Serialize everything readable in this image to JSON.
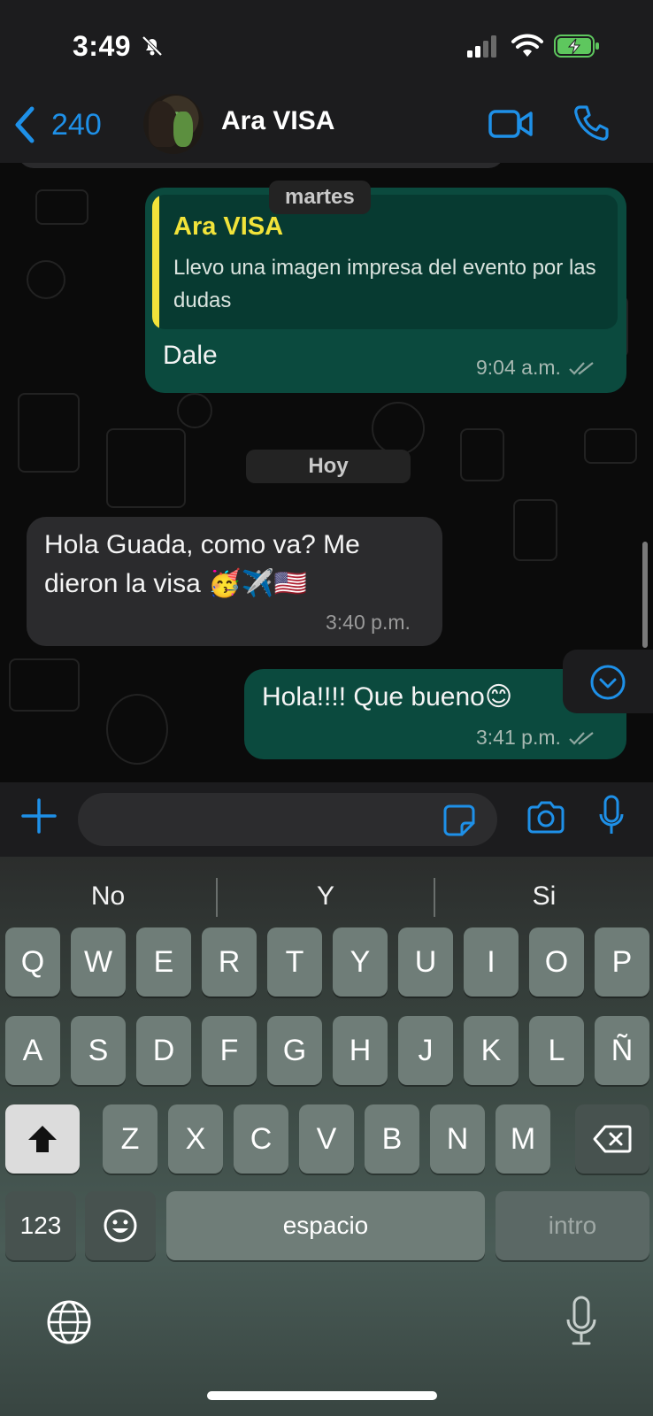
{
  "status_bar": {
    "time": "3:49",
    "icons": [
      "bell-slash-icon",
      "cellular-signal-icon",
      "wifi-icon",
      "battery-charging-icon"
    ]
  },
  "header": {
    "back_count": "240",
    "contact_name": "Ara VISA",
    "actions": [
      "video-call-icon",
      "phone-call-icon"
    ]
  },
  "chat": {
    "date_separators": [
      "martes",
      "Hoy"
    ],
    "messages": [
      {
        "direction": "outgoing",
        "quoted_author": "Ara VISA",
        "quoted_text": "Llevo una imagen impresa del evento por las dudas",
        "text": "Dale",
        "time": "9:04 a.m.",
        "read": true
      },
      {
        "direction": "incoming",
        "text_line1": "Hola Guada, como va? Me",
        "text_line2": "dieron la visa",
        "emojis": "🥳✈️🇺🇸",
        "time": "3:40 p.m."
      },
      {
        "direction": "outgoing",
        "text": "Hola!!!! Que bueno",
        "emoji": "😊",
        "time": "3:41 p.m.",
        "read": true
      }
    ]
  },
  "composer": {
    "value": "",
    "icons": [
      "plus-icon",
      "sticker-icon",
      "camera-icon",
      "microphone-icon"
    ]
  },
  "keyboard": {
    "suggestions": [
      "No",
      "Y",
      "Si"
    ],
    "row1": [
      "Q",
      "W",
      "E",
      "R",
      "T",
      "Y",
      "U",
      "I",
      "O",
      "P"
    ],
    "row2": [
      "A",
      "S",
      "D",
      "F",
      "G",
      "H",
      "J",
      "K",
      "L",
      "Ñ"
    ],
    "row3": [
      "Z",
      "X",
      "C",
      "V",
      "B",
      "N",
      "M"
    ],
    "numbers_key": "123",
    "space_key": "espacio",
    "return_key": "intro"
  },
  "colors": {
    "accent": "#1e90e8",
    "outgoing_bubble": "#0b4a3e",
    "incoming_bubble": "#2b2b2d",
    "quote_name": "#f1e33a"
  }
}
